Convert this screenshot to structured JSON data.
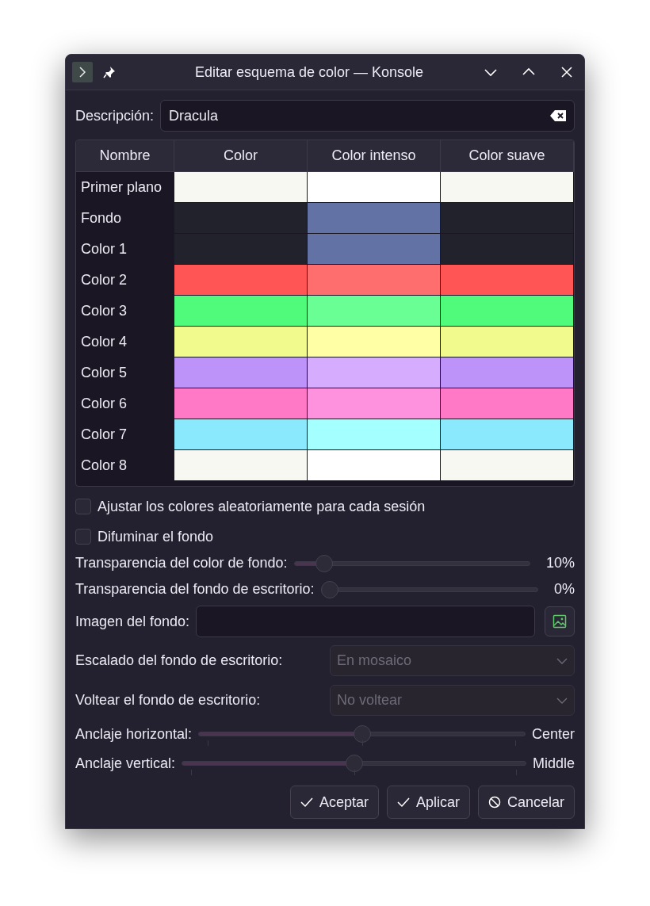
{
  "window": {
    "title": "Editar esquema de color — Konsole"
  },
  "description": {
    "label": "Descripción:",
    "value": "Dracula"
  },
  "table": {
    "columns": [
      "Nombre",
      "Color",
      "Color intenso",
      "Color suave"
    ],
    "rows": [
      {
        "name": "Primer plano",
        "colors": [
          {
            "color": "#f8f8f2"
          },
          {
            "color": "#ffffff"
          },
          {
            "color": "#f8f8f2"
          }
        ]
      },
      {
        "name": "Fondo",
        "colors": [
          {
            "color": "#21222c"
          },
          {
            "color": "#6272a4"
          },
          {
            "color": "#21222c"
          }
        ]
      },
      {
        "name": "Color 1",
        "colors": [
          {
            "color": "#21222c"
          },
          {
            "color": "#6272a4"
          },
          {
            "color": "#21222c"
          }
        ]
      },
      {
        "name": "Color 2",
        "colors": [
          {
            "color": "#ff5555"
          },
          {
            "color": "#ff6e6e"
          },
          {
            "color": "#ff5555"
          }
        ]
      },
      {
        "name": "Color 3",
        "colors": [
          {
            "color": "#50fa7b"
          },
          {
            "color": "#69ff94"
          },
          {
            "color": "#50fa7b"
          }
        ]
      },
      {
        "name": "Color 4",
        "colors": [
          {
            "color": "#f1fa8c"
          },
          {
            "color": "#ffffa5"
          },
          {
            "color": "#f1fa8c"
          }
        ]
      },
      {
        "name": "Color 5",
        "colors": [
          {
            "color": "#bd93f9"
          },
          {
            "color": "#d6acff"
          },
          {
            "color": "#bd93f9"
          }
        ]
      },
      {
        "name": "Color 6",
        "colors": [
          {
            "color": "#ff79c6"
          },
          {
            "color": "#ff92df"
          },
          {
            "color": "#ff79c6"
          }
        ]
      },
      {
        "name": "Color 7",
        "colors": [
          {
            "color": "#8be9fd"
          },
          {
            "color": "#a4ffff"
          },
          {
            "color": "#8be9fd"
          }
        ]
      },
      {
        "name": "Color 8",
        "colors": [
          {
            "color": "#f8f8f2"
          },
          {
            "color": "#ffffff"
          },
          {
            "color": "#f8f8f2"
          }
        ]
      }
    ]
  },
  "checkboxes": [
    {
      "label": "Ajustar los colores aleatoriamente para cada sesión",
      "checked": false
    },
    {
      "label": "Difuminar el fondo",
      "checked": false
    }
  ],
  "transparency": [
    {
      "label": "Transparencia del color de fondo:",
      "level": 0.1,
      "reading": "10%"
    },
    {
      "label": "Transparencia del fondo de escritorio:",
      "level": 0,
      "reading": "0%"
    }
  ],
  "image": {
    "label": "Imagen del fondo:"
  },
  "dropdowns": [
    {
      "label": "Escalado del fondo de escritorio:",
      "value": "En mosaico",
      "disabled": true
    },
    {
      "label": "Voltear el fondo de escritorio:",
      "value": "No voltear",
      "disabled": true
    }
  ],
  "anchors": [
    {
      "label": "Anclaje horizontal:",
      "level": 0.5,
      "reading": "Center"
    },
    {
      "label": "Anclaje vertical:",
      "level": 0.5,
      "reading": "Middle"
    }
  ],
  "buttons": [
    {
      "label": "Aceptar",
      "kind": "check"
    },
    {
      "label": "Aplicar",
      "kind": "check"
    },
    {
      "label": "Cancelar",
      "kind": "cancel"
    }
  ]
}
